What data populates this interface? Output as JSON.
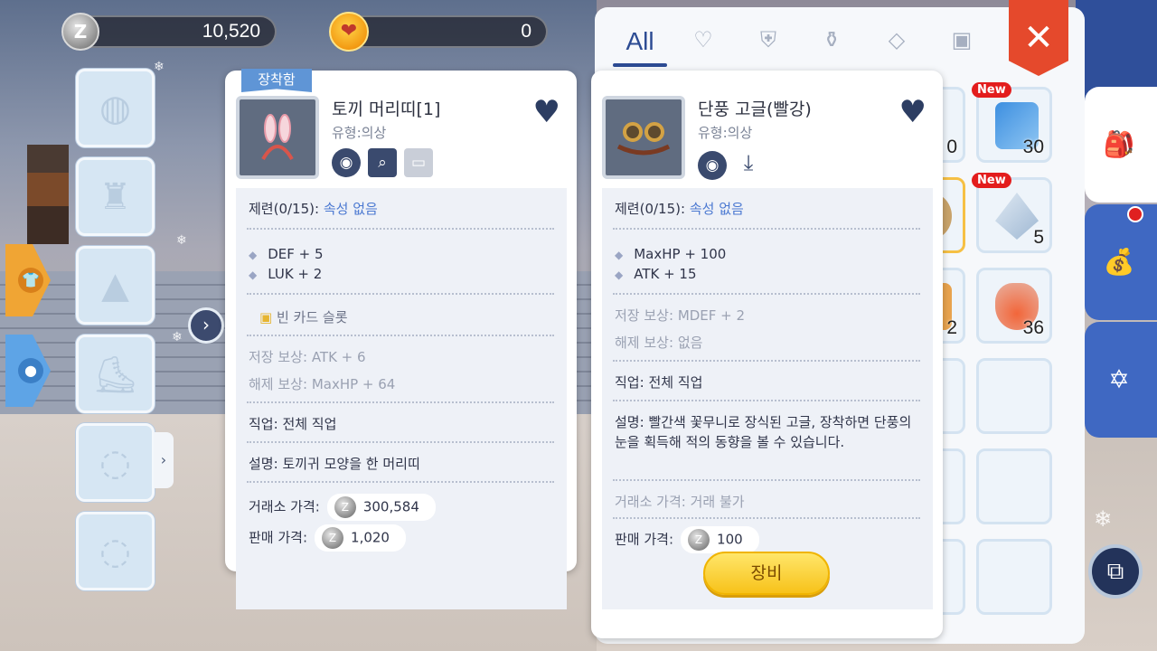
{
  "currency": {
    "zeny": "10,520",
    "cash": "0"
  },
  "inventory": {
    "tabs": [
      {
        "label": "All",
        "icon": "all-tab"
      },
      {
        "icon": "heart-icon"
      },
      {
        "icon": "armor-icon"
      },
      {
        "icon": "potion-icon"
      },
      {
        "icon": "gem-icon"
      },
      {
        "icon": "card-icon"
      }
    ],
    "slots": [
      {
        "count": "0"
      },
      {
        "count": "30",
        "badge": "New"
      },
      {
        "count": ""
      },
      {
        "count": "5",
        "badge": "New"
      },
      {
        "count": "2"
      },
      {
        "count": "36"
      }
    ]
  },
  "card_a": {
    "badge": "장착함",
    "name": "토끼 머리띠[1]",
    "type": "유형:의상",
    "refine_label": "제련(0/15):",
    "refine_value": "속성 없음",
    "stats": [
      "DEF + 5",
      "LUK + 2"
    ],
    "card_slot": "빈 카드 슬롯",
    "deposit_label": "저장 보상:",
    "deposit_value": "ATK + 6",
    "unlock_label": "해제 보상:",
    "unlock_value": "MaxHP + 64",
    "job_label": "직업:",
    "job_value": "전체 직업",
    "desc_label": "설명:",
    "desc_value": "토끼귀 모양을 한 머리띠",
    "market_label": "거래소 가격:",
    "market_value": "300,584",
    "sell_label": "판매 가격:",
    "sell_value": "1,020"
  },
  "card_b": {
    "name": "단풍 고글(빨강)",
    "type": "유형:의상",
    "refine_label": "제련(0/15):",
    "refine_value": "속성 없음",
    "stats": [
      "MaxHP + 100",
      "ATK + 15"
    ],
    "deposit_label": "저장 보상:",
    "deposit_value": "MDEF + 2",
    "unlock_label": "해제 보상:",
    "unlock_value": "없음",
    "job_label": "직업:",
    "job_value": "전체 직업",
    "desc_label": "설명:",
    "desc_value": "빨간색 꽃무니로 장식된 고글, 장착하면 단풍의 눈을 획득해 적의 동향을 볼 수 있습니다.",
    "market_label": "거래소 가격:",
    "market_value": "거래 불가",
    "sell_label": "판매 가격:",
    "sell_value": "100",
    "equip_button": "장비"
  },
  "colors": {
    "accent": "#2c4b93",
    "close": "#e5492c",
    "equip_button": "#f7c21a",
    "badge": "#5f95d6"
  }
}
